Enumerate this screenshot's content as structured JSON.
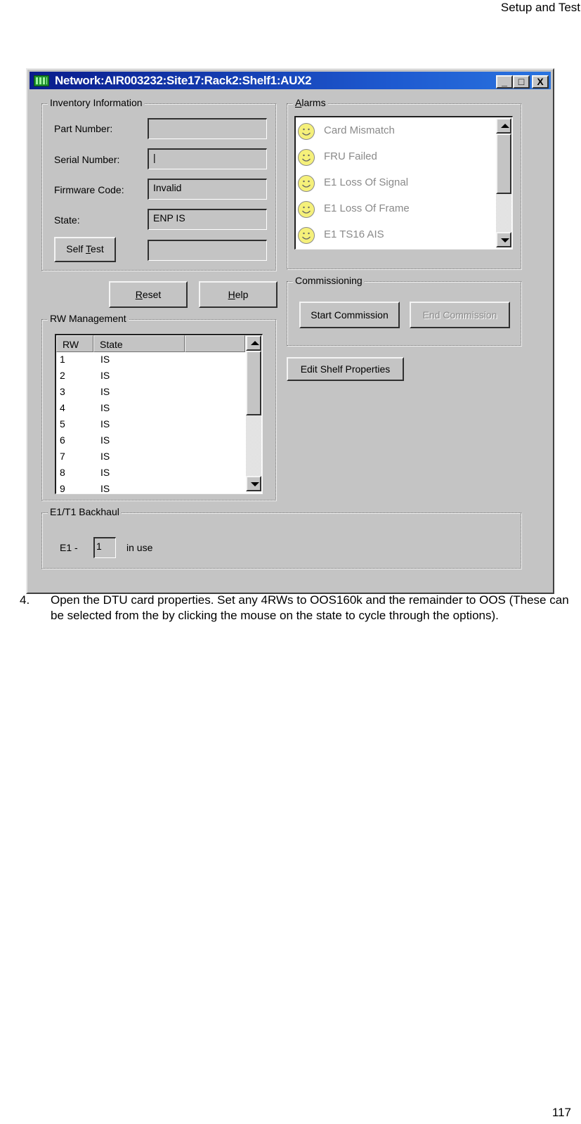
{
  "page": {
    "header": "Setup and Test",
    "page_number": "117"
  },
  "window": {
    "title": "Network:AIR003232:Site17:Rack2:Shelf1:AUX2",
    "controls": {
      "minimize": "_",
      "maximize": "□",
      "close": "X"
    },
    "inventory": {
      "title": "Inventory Information",
      "part_number_label": "Part Number:",
      "part_number_value": "",
      "serial_number_label": "Serial Number:",
      "serial_number_value": "|",
      "firmware_code_label": "Firmware Code:",
      "firmware_code_value": "Invalid",
      "state_label": "State:",
      "state_value": "ENP IS",
      "self_test_prefix": "Self ",
      "self_test_mnemonic": "T",
      "self_test_suffix": "est",
      "self_test_result": ""
    },
    "alarms": {
      "title_mnemonic": "A",
      "title_rest": "larms",
      "items": [
        {
          "icon": "smiley-icon",
          "label": "Card Mismatch"
        },
        {
          "icon": "smiley-icon",
          "label": "FRU Failed"
        },
        {
          "icon": "smiley-icon",
          "label": "E1 Loss Of Signal"
        },
        {
          "icon": "smiley-icon",
          "label": "E1 Loss Of Frame"
        },
        {
          "icon": "smiley-icon",
          "label": "E1 TS16 AIS"
        }
      ]
    },
    "buttons": {
      "reset_mnemonic": "R",
      "reset_rest": "eset",
      "help_mnemonic": "H",
      "help_rest": "elp",
      "edit_shelf": "Edit Shelf Properties"
    },
    "commissioning": {
      "title": "Commissioning",
      "start": "Start Commission",
      "end": "End Commission",
      "end_enabled": false
    },
    "rw_management": {
      "title": "RW Management",
      "columns": [
        "RW",
        "State",
        ""
      ],
      "rows": [
        {
          "rw": "1",
          "state": "IS"
        },
        {
          "rw": "2",
          "state": "IS"
        },
        {
          "rw": "3",
          "state": "IS"
        },
        {
          "rw": "4",
          "state": "IS"
        },
        {
          "rw": "5",
          "state": "IS"
        },
        {
          "rw": "6",
          "state": "IS"
        },
        {
          "rw": "7",
          "state": "IS"
        },
        {
          "rw": "8",
          "state": "IS"
        },
        {
          "rw": "9",
          "state": "IS"
        }
      ]
    },
    "backhaul": {
      "title": "E1/T1 Backhaul",
      "e1_label": "E1 -",
      "e1_value": "1",
      "in_use_label": "in use"
    }
  },
  "instruction": {
    "number": "4.",
    "text": "Open the DTU card properties. Set any 4RWs to OOS160k and the remainder to OOS (These can be selected from the by clicking the mouse on the state to cycle through the options)."
  },
  "colors": {
    "titlebar_start": "#0a1c8c",
    "titlebar_end": "#2a74e0",
    "window_bg": "#c4c4c4",
    "alarm_text": "#8a8a8a",
    "smiley": "#f5f07a"
  }
}
